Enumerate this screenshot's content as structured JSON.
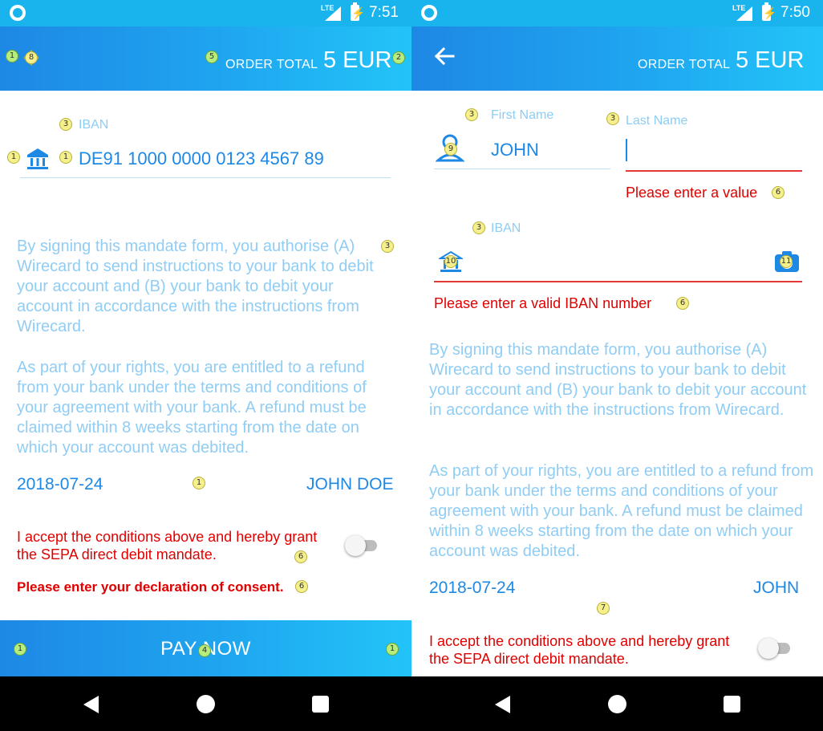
{
  "screen_left": {
    "status_bar": {
      "network": "LTE",
      "time": "7:51"
    },
    "app_bar": {
      "order_total_label": "ORDER TOTAL",
      "order_total_value": "5 EUR"
    },
    "iban": {
      "label": "IBAN",
      "value": "DE91 1000 0000 0123 4567 89"
    },
    "mandate_text": {
      "paragraph1": "By signing this mandate form, you authorise (A) Wirecard to send instructions to your bank to debit your account and (B) your bank to debit your account in accordance with the instructions from Wirecard.",
      "paragraph2": "As part of your rights, you are entitled to a refund from your bank under the terms and conditions of your agreement with your bank. A refund must be claimed within 8 weeks starting from the date on which your account was debited."
    },
    "date": "2018-07-24",
    "signer": "JOHN DOE",
    "consent": {
      "text": "I accept the conditions above and hereby grant the SEPA direct debit mandate.",
      "checked": false,
      "error": "Please enter your declaration of consent."
    },
    "pay_button_label": "PAY NOW",
    "badges": {
      "b1": "1",
      "b2": "2",
      "b3": "3",
      "b4": "4",
      "b5": "5",
      "b6": "6",
      "b8": "8"
    }
  },
  "screen_right": {
    "status_bar": {
      "network": "LTE",
      "time": "7:50"
    },
    "app_bar": {
      "order_total_label": "ORDER TOTAL",
      "order_total_value": "5 EUR"
    },
    "first_name": {
      "label": "First Name",
      "value": "JOHN"
    },
    "last_name": {
      "label": "Last Name",
      "value": "",
      "error": "Please enter a value"
    },
    "iban": {
      "label": "IBAN",
      "value": "",
      "error": "Please enter a valid IBAN number"
    },
    "mandate_text": {
      "paragraph1": "By signing this mandate form, you authorise (A) Wirecard to send instructions to your bank to debit your account and (B) your bank to debit your account in accordance with the instructions from Wirecard.",
      "paragraph2": "As part of your rights, you are entitled to a refund from your bank under the terms and conditions of your agreement with your bank. A refund must be claimed within 8 weeks starting from the date on which your account was debited."
    },
    "date": "2018-07-24",
    "signer": "JOHN",
    "consent": {
      "text": "I accept the conditions above and hereby grant the SEPA direct debit mandate.",
      "checked": false
    },
    "badges": {
      "b3": "3",
      "b6": "6",
      "b7": "7",
      "b9": "9",
      "b10": "10",
      "b11": "11"
    }
  },
  "colors": {
    "accent": "#1e88e5",
    "app_bar_end": "#22c4f8",
    "error": "#e00000",
    "muted_text": "#90cdf4"
  }
}
